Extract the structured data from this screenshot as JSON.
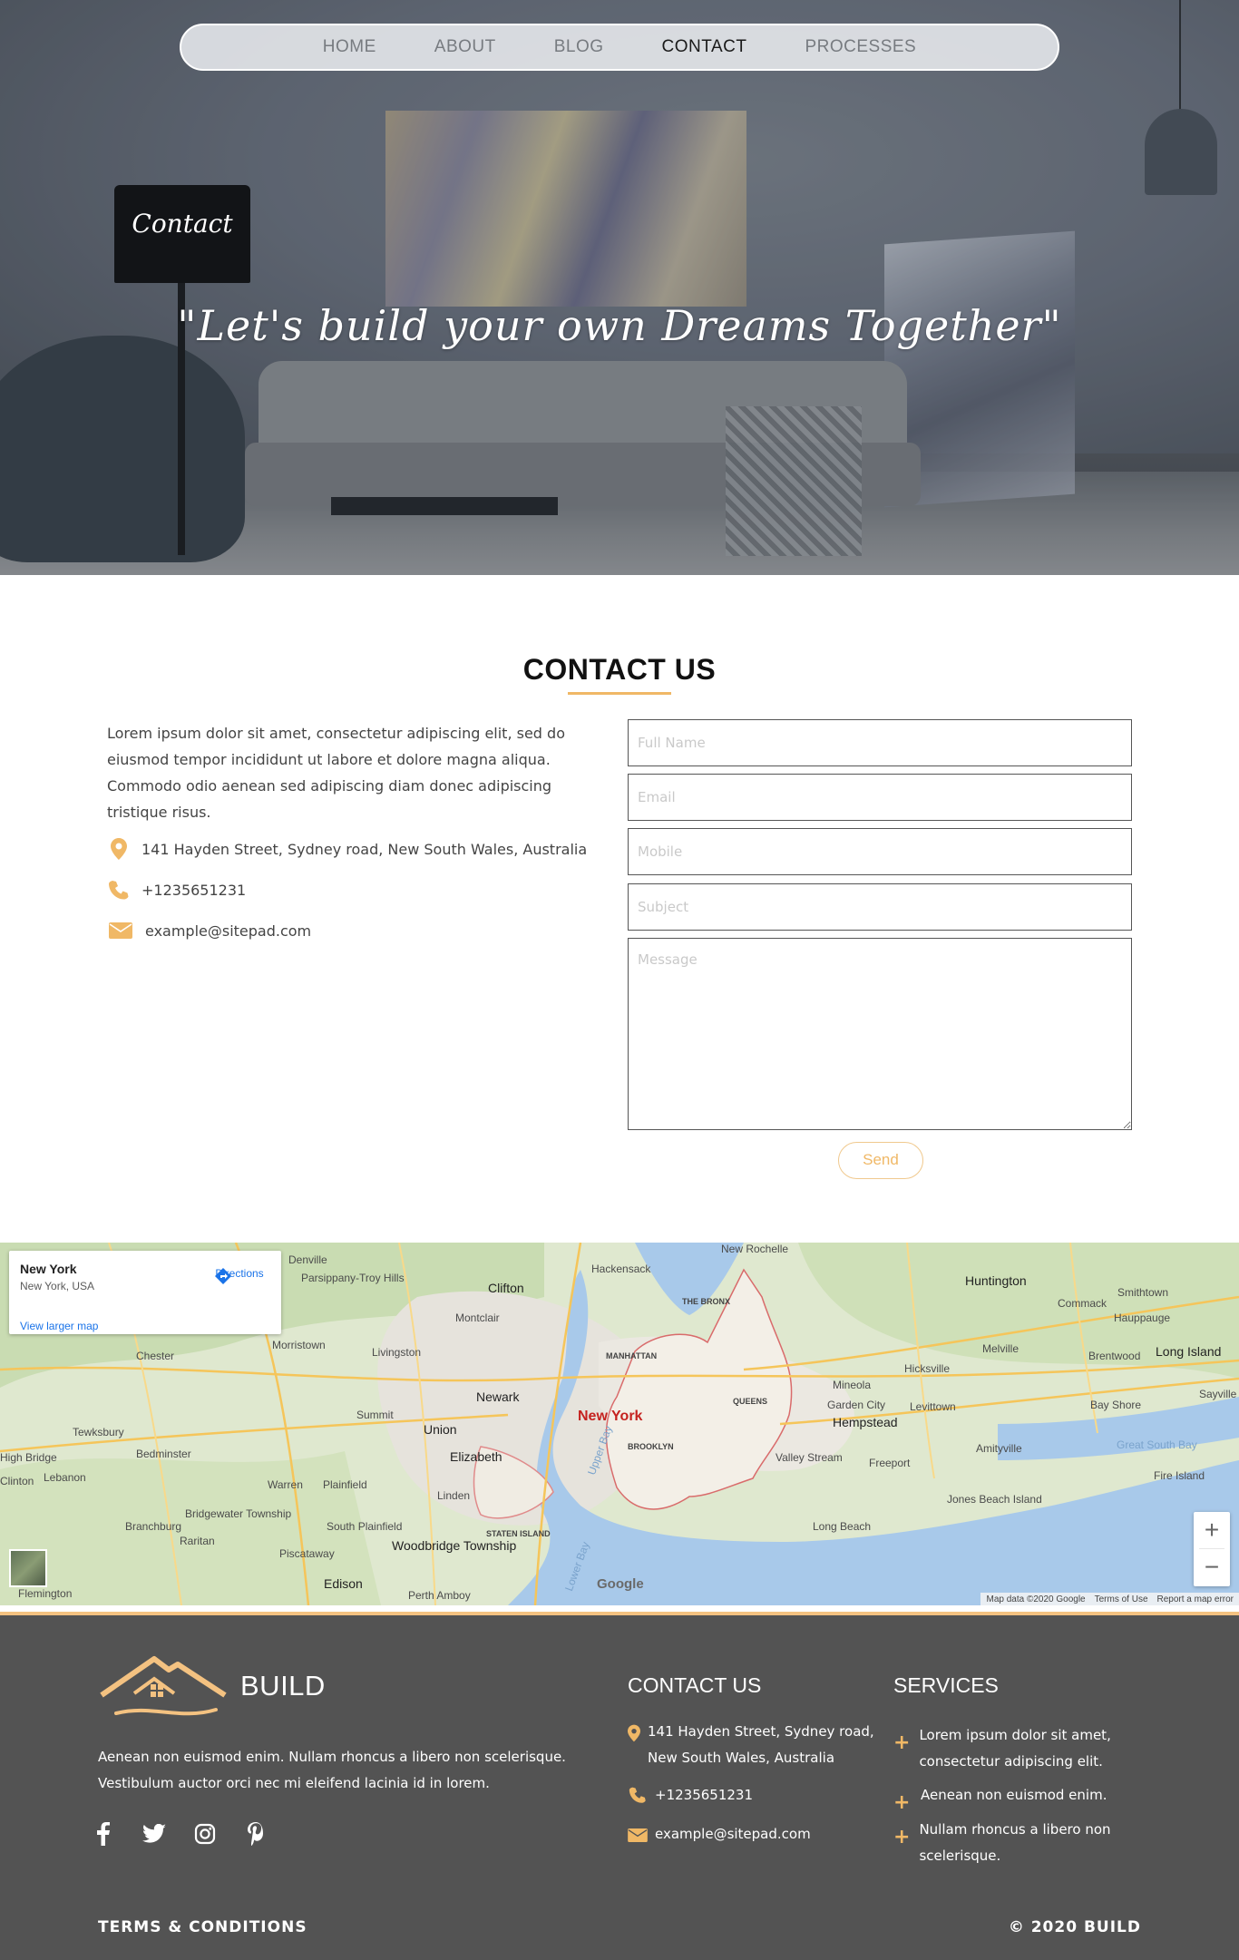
{
  "nav": {
    "items": [
      {
        "label": "HOME",
        "active": false
      },
      {
        "label": "ABOUT",
        "active": false
      },
      {
        "label": "BLOG",
        "active": false
      },
      {
        "label": "CONTACT",
        "active": true
      },
      {
        "label": "PROCESSES",
        "active": false
      }
    ]
  },
  "hero": {
    "lamp_label": "Contact",
    "tagline": "\"Let's build your own Dreams Together\""
  },
  "contact": {
    "title": "CONTACT US",
    "intro": "Lorem ipsum dolor sit amet, consectetur adipiscing elit, sed do eiusmod tempor incididunt ut labore et dolore magna aliqua. Commodo odio aenean sed adipiscing diam donec adipiscing tristique risus.",
    "address": "141 Hayden Street, Sydney road, New South Wales, Australia",
    "phone": "+1235651231",
    "email": "example@sitepad.com",
    "accent_color": "#f0b866",
    "form": {
      "full_name_placeholder": "Full Name",
      "email_placeholder": "Email",
      "mobile_placeholder": "Mobile",
      "subject_placeholder": "Subject",
      "message_placeholder": "Message",
      "send_label": "Send"
    }
  },
  "map": {
    "place_title": "New York",
    "place_subtitle": "New York, USA",
    "directions_label": "Directions",
    "larger_map_label": "View larger map",
    "city_label": "New York",
    "google_label": "Google",
    "zoom_in": "+",
    "zoom_out": "−",
    "attribution": [
      "Map data ©2020 Google",
      "Terms of Use",
      "Report a map error"
    ],
    "labels": [
      {
        "text": "Denville"
      },
      {
        "text": "Parsippany-Troy Hills"
      },
      {
        "text": "Clifton"
      },
      {
        "text": "Hackensack"
      },
      {
        "text": "New Rochelle"
      },
      {
        "text": "Huntington"
      },
      {
        "text": "Smithtown"
      },
      {
        "text": "Commack"
      },
      {
        "text": "Hauppauge"
      },
      {
        "text": "Chester"
      },
      {
        "text": "Morristown"
      },
      {
        "text": "Livingston"
      },
      {
        "text": "Montclair"
      },
      {
        "text": "THE BRONX"
      },
      {
        "text": "MANHATTAN"
      },
      {
        "text": "Melville"
      },
      {
        "text": "Brentwood"
      },
      {
        "text": "Long Island"
      },
      {
        "text": "Hicksville"
      },
      {
        "text": "Newark"
      },
      {
        "text": "QUEENS"
      },
      {
        "text": "Mineola"
      },
      {
        "text": "Garden City"
      },
      {
        "text": "Bay Shore"
      },
      {
        "text": "Sayville"
      },
      {
        "text": "Tewksbury"
      },
      {
        "text": "Summit"
      },
      {
        "text": "Union"
      },
      {
        "text": "Hempstead"
      },
      {
        "text": "Levittown"
      },
      {
        "text": "Bedminster"
      },
      {
        "text": "Elizabeth"
      },
      {
        "text": "BROOKLYN"
      },
      {
        "text": "Valley Stream"
      },
      {
        "text": "Freeport"
      },
      {
        "text": "Amityville"
      },
      {
        "text": "Great South Bay"
      },
      {
        "text": "High Bridge"
      },
      {
        "text": "Clinton"
      },
      {
        "text": "Lebanon"
      },
      {
        "text": "Warren"
      },
      {
        "text": "Plainfield"
      },
      {
        "text": "Linden"
      },
      {
        "text": "Fire Island"
      },
      {
        "text": "Jones Beach Island"
      },
      {
        "text": "Bridgewater Township"
      },
      {
        "text": "Branchburg"
      },
      {
        "text": "Raritan"
      },
      {
        "text": "South Plainfield"
      },
      {
        "text": "STATEN ISLAND"
      },
      {
        "text": "Long Beach"
      },
      {
        "text": "Woodbridge Township"
      },
      {
        "text": "Piscataway"
      },
      {
        "text": "Edison"
      },
      {
        "text": "Perth Amboy"
      },
      {
        "text": "Flemington"
      },
      {
        "text": "Upper Bay"
      },
      {
        "text": "Lower Bay"
      }
    ]
  },
  "footer": {
    "brand": "BUILD",
    "text": "Aenean non euismod enim. Nullam rhoncus a libero non scelerisque. Vestibulum auctor orci nec mi eleifend lacinia id in lorem.",
    "contact_title": "CONTACT US",
    "address": "141 Hayden Street, Sydney road, New South Wales, Australia",
    "phone": "+1235651231",
    "email": "example@sitepad.com",
    "services_title": "SERVICES",
    "services": [
      "Lorem ipsum dolor sit amet, consectetur adipiscing elit.",
      "Aenean non euismod enim.",
      "Nullam rhoncus a libero non scelerisque."
    ],
    "terms": "TERMS & CONDITIONS",
    "copyright": "© 2020 BUILD",
    "socials": [
      "facebook-icon",
      "twitter-icon",
      "instagram-icon",
      "pinterest-icon"
    ]
  }
}
